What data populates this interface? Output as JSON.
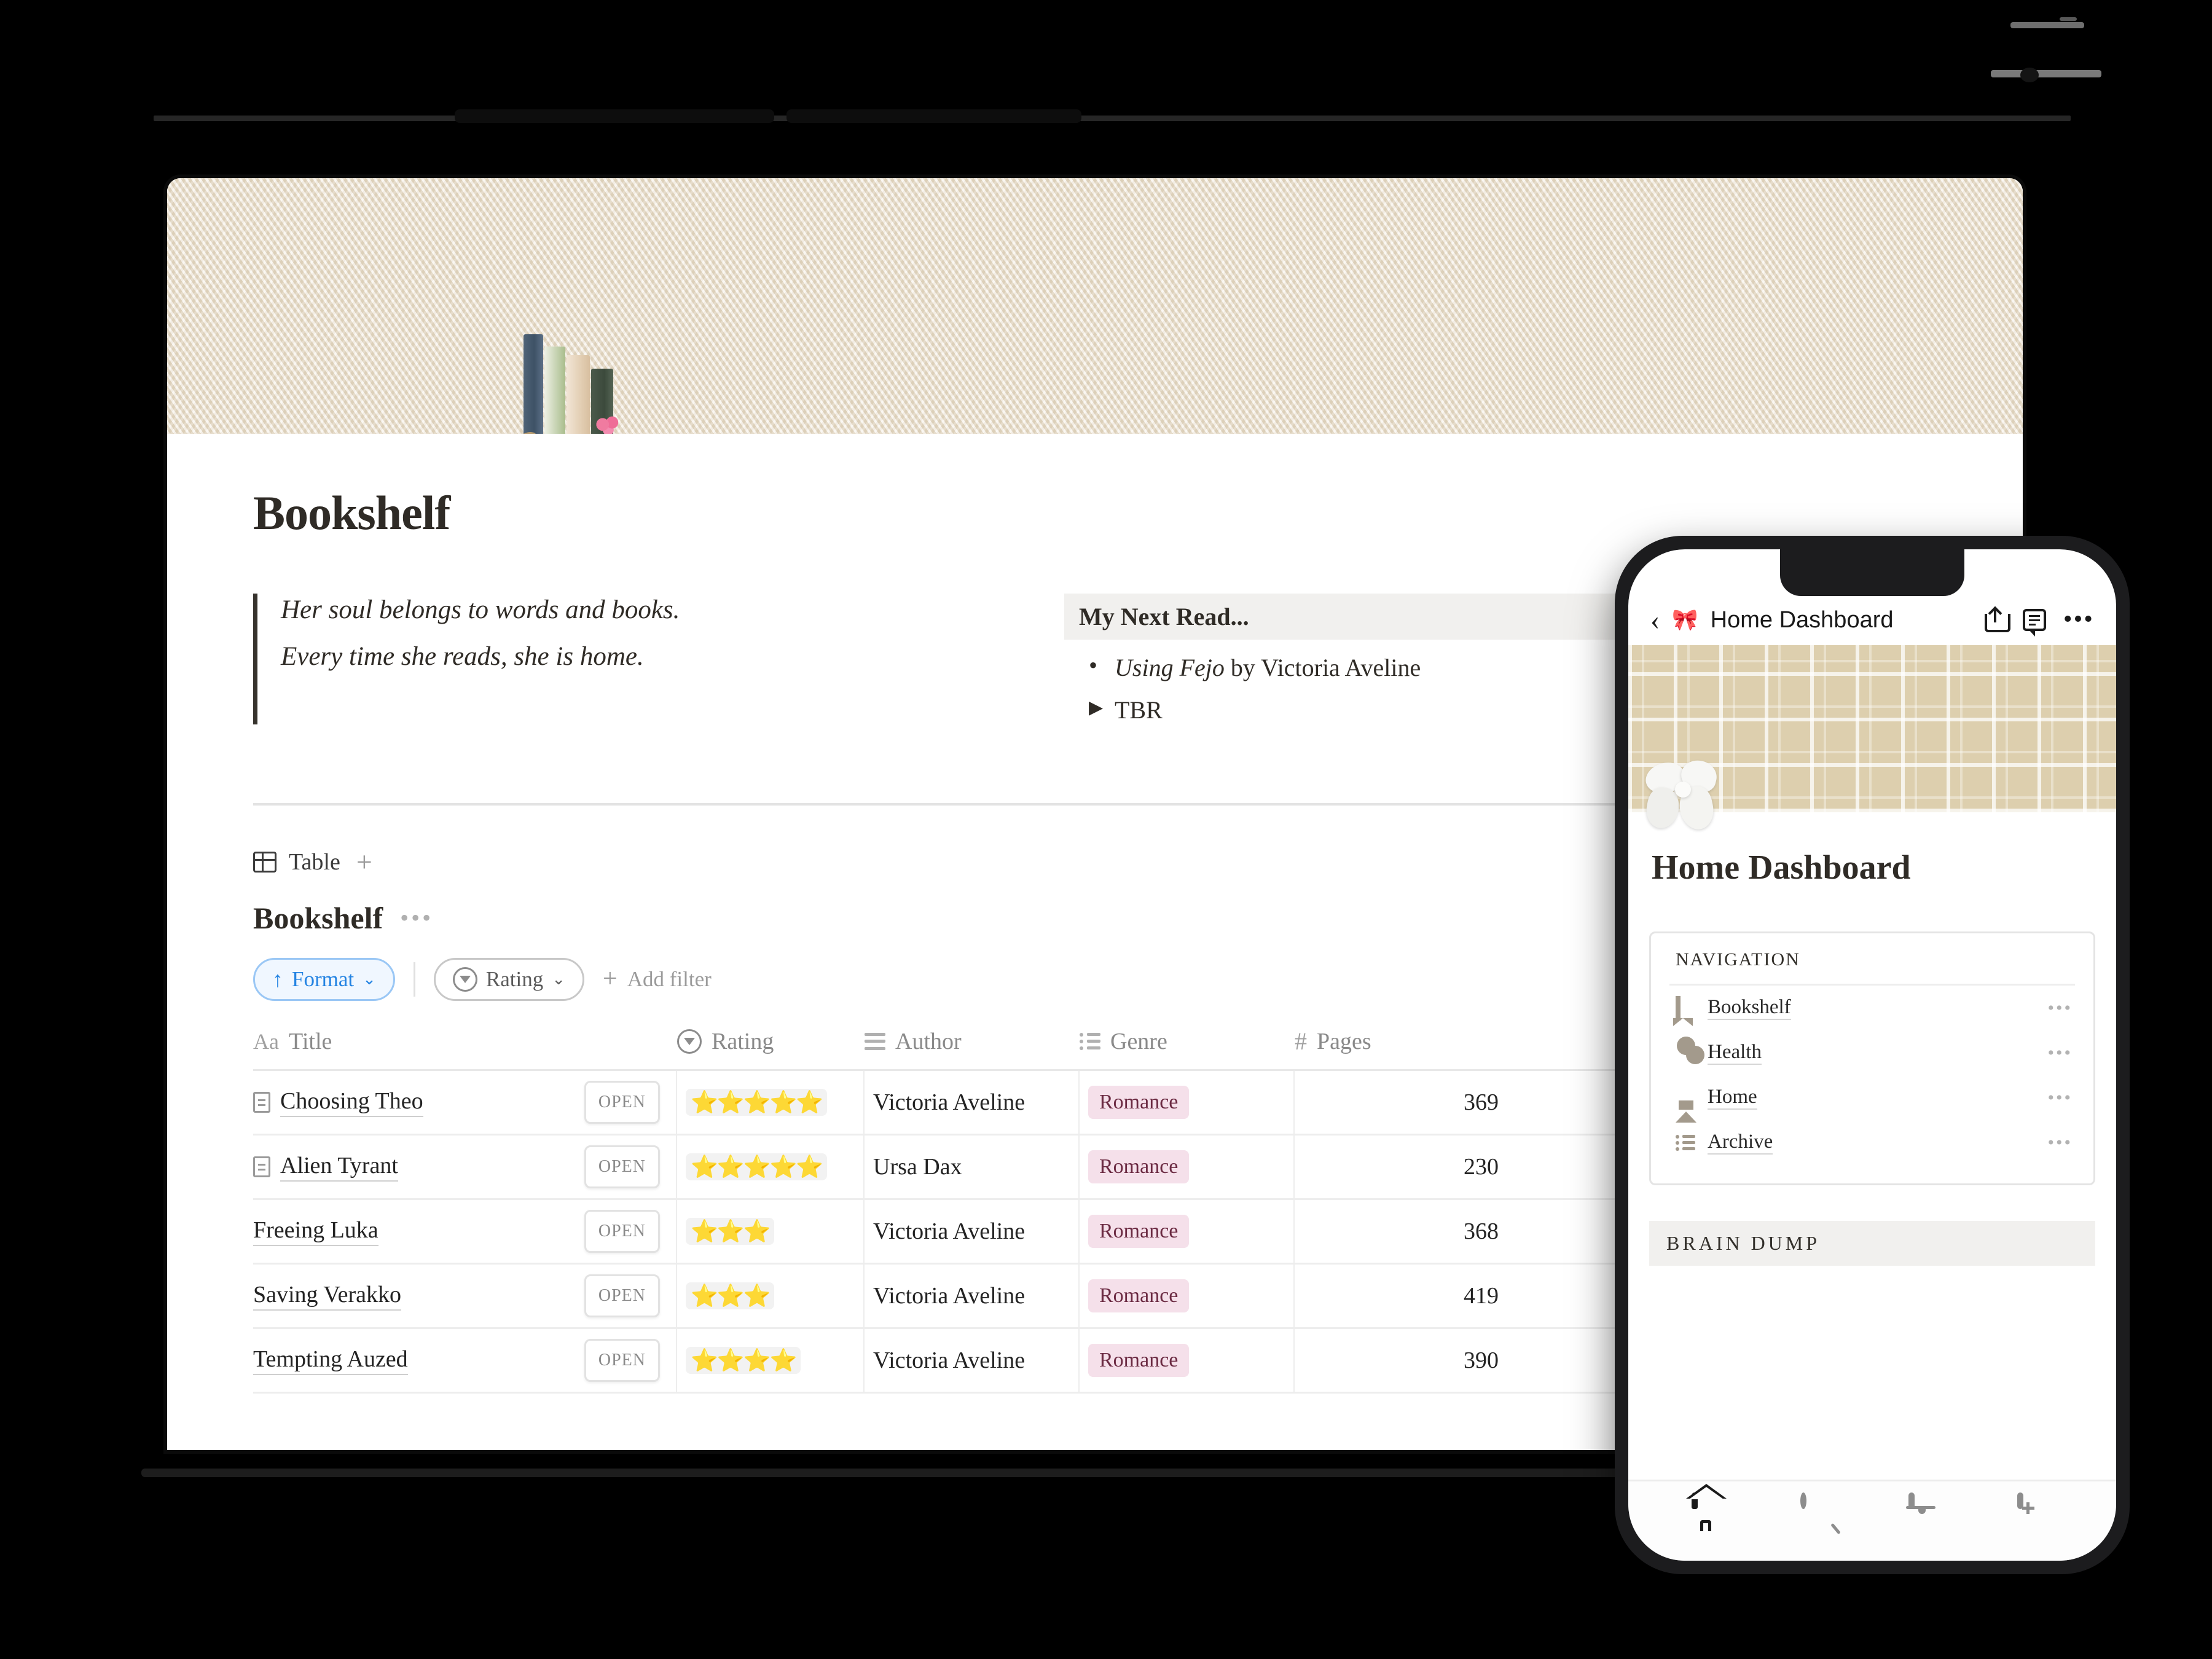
{
  "tablet": {
    "page_title": "Bookshelf",
    "quote": {
      "line1": "Her soul belongs to words and books.",
      "line2": "Every time she reads, she is home."
    },
    "next_read": {
      "heading": "My Next Read...",
      "bullet": "•",
      "book_title_italic": "Using Fejo",
      "book_by": " by Victoria Aveline",
      "toggle_arrow": "▶",
      "toggle_label": "TBR"
    },
    "view_bar": {
      "table_tab": "Table",
      "add_view": "+",
      "sort_indicator": "↑"
    },
    "database": {
      "name": "Bookshelf",
      "more": "•••",
      "chips": {
        "format": "Format",
        "format_arrow": "↑",
        "format_chevron": "⌄",
        "rating": "Rating",
        "rating_chevron": "⌄",
        "add_filter": "Add filter",
        "add_filter_plus": "+"
      },
      "columns": [
        "Title",
        "Rating",
        "Author",
        "Genre",
        "Pages"
      ],
      "col_icons": [
        "Aa",
        "rating-icon",
        "text-lines-icon",
        "multi-select-icon",
        "#"
      ],
      "open_label": "OPEN",
      "rows": [
        {
          "title": "Choosing Theo",
          "has_doc_icon": true,
          "rating": "⭐⭐⭐⭐⭐",
          "stars": 5,
          "author": "Victoria Aveline",
          "genre": "Romance",
          "pages": "369"
        },
        {
          "title": "Alien Tyrant",
          "has_doc_icon": true,
          "rating": "⭐⭐⭐⭐⭐",
          "stars": 5,
          "author": "Ursa Dax",
          "genre": "Romance",
          "pages": "230"
        },
        {
          "title": "Freeing Luka",
          "has_doc_icon": false,
          "rating": "⭐⭐⭐",
          "stars": 3,
          "author": "Victoria Aveline",
          "genre": "Romance",
          "pages": "368"
        },
        {
          "title": "Saving Verakko",
          "has_doc_icon": false,
          "rating": "⭐⭐⭐",
          "stars": 3,
          "author": "Victoria Aveline",
          "genre": "Romance",
          "pages": "419"
        },
        {
          "title": "Tempting Auzed",
          "has_doc_icon": false,
          "rating": "⭐⭐⭐⭐",
          "stars": 4,
          "author": "Victoria Aveline",
          "genre": "Romance",
          "pages": "390"
        }
      ]
    },
    "colors": {
      "accent_blue": "#2383e2",
      "tag_bg": "#f5e0ea",
      "tag_text": "#6b2a42",
      "cover_beige": "#ece2cf",
      "callout_bg": "#f1f0ee"
    }
  },
  "phone": {
    "topbar": {
      "back": "‹",
      "icon": "🎀",
      "title": "Home Dashboard",
      "share": "share-icon",
      "comment": "comment-icon",
      "more": "•••"
    },
    "page_title": "Home Dashboard",
    "nav_card": {
      "heading": "NAVIGATION",
      "items": [
        {
          "label": "Bookshelf",
          "icon": "bookmark-icon",
          "more": "•••"
        },
        {
          "label": "Health",
          "icon": "heart-pulse-icon",
          "more": "•••"
        },
        {
          "label": "Home",
          "icon": "house-icon",
          "more": "•••"
        },
        {
          "label": "Archive",
          "icon": "list-icon",
          "more": "•••"
        }
      ]
    },
    "brain_dump": "BRAIN DUMP",
    "tabbar": [
      "home-icon",
      "search-icon",
      "bell-icon",
      "new-page-icon"
    ]
  }
}
